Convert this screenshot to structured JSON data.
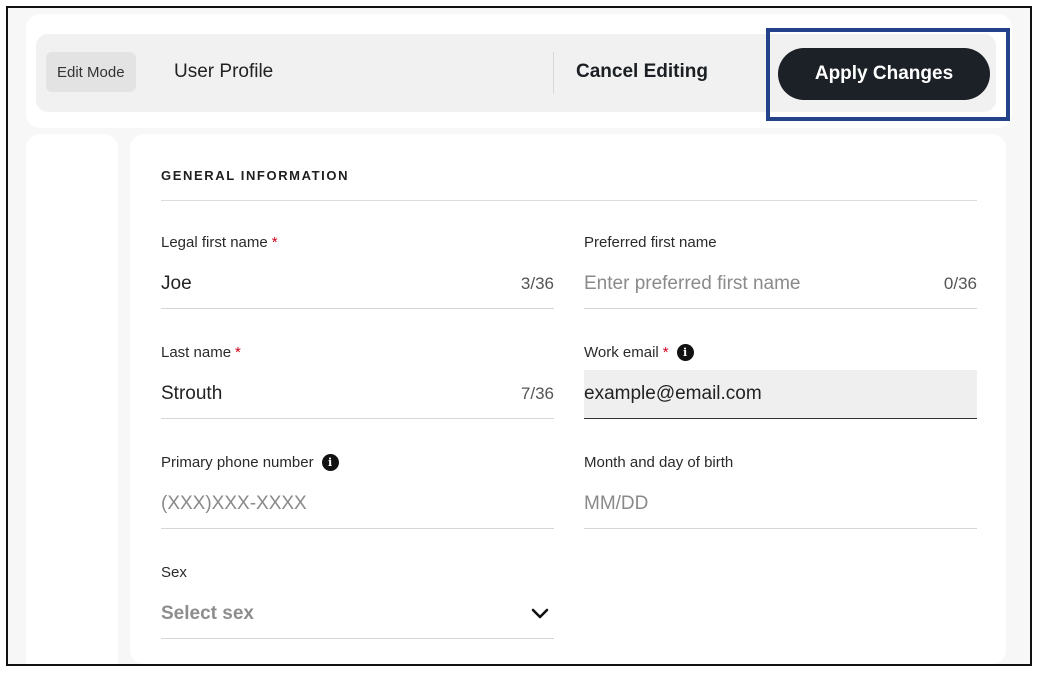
{
  "header": {
    "mode_badge": "Edit Mode",
    "page_title": "User Profile",
    "cancel_label": "Cancel Editing",
    "apply_label": "Apply Changes"
  },
  "section": {
    "title": "GENERAL INFORMATION"
  },
  "fields": {
    "legal_first_name": {
      "label": "Legal first name",
      "required": "*",
      "value": "Joe",
      "counter": "3/36"
    },
    "preferred_first_name": {
      "label": "Preferred first name",
      "value": "",
      "placeholder": "Enter preferred first name",
      "counter": "0/36"
    },
    "last_name": {
      "label": "Last name",
      "required": "*",
      "value": "Strouth",
      "counter": "7/36"
    },
    "work_email": {
      "label": "Work email",
      "required": "*",
      "info": "i",
      "value": "example@email.com"
    },
    "primary_phone": {
      "label": "Primary phone number",
      "info": "i",
      "value": "",
      "placeholder": "(XXX)XXX-XXXX"
    },
    "birth_month_day": {
      "label": "Month and day of birth",
      "value": "",
      "placeholder": "MM/DD"
    },
    "sex": {
      "label": "Sex",
      "selected": "Select sex"
    }
  },
  "icons": {
    "info": "info-icon",
    "chevron": "chevron-down-icon"
  },
  "colors": {
    "apply_button_bg": "#1c2027",
    "highlight_border": "#24428a",
    "required_asterisk": "#d0021b"
  }
}
